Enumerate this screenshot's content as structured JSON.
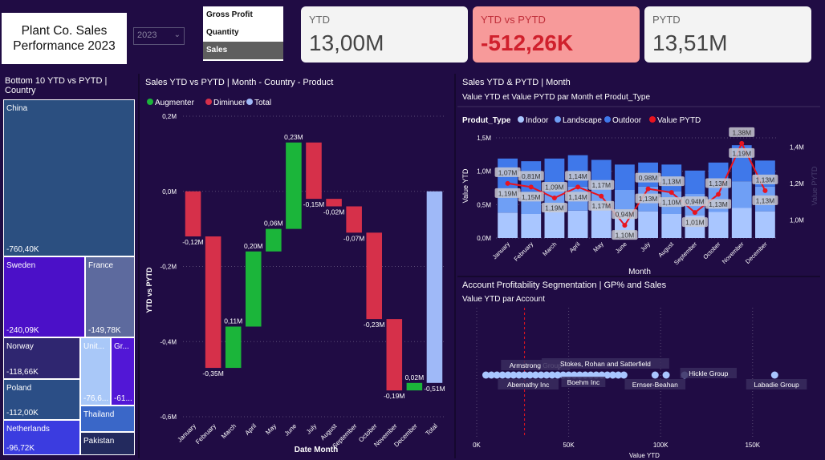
{
  "header": {
    "title_line1": "Plant Co. Sales",
    "title_line2": "Performance 2023",
    "year_value": "2023",
    "metric_options": [
      "Gross Profit",
      "Quantity",
      "Sales"
    ],
    "selected_metric": "Sales"
  },
  "kpis": [
    {
      "label": "YTD",
      "value": "13,00M"
    },
    {
      "label": "YTD vs PYTD",
      "value": "-512,26K"
    },
    {
      "label": "PYTD",
      "value": "13,51M"
    }
  ],
  "colors": {
    "increase": "#1bb53a",
    "decrease": "#d6304a",
    "total": "#9fb9f8",
    "indoor": "#a9c6ff",
    "landscape": "#6f9ff5",
    "outdoor": "#3f78ea",
    "pytd": "#e8141f",
    "treemap_blue": "#2b4f80",
    "treemap_purple": "#4b10c8"
  },
  "chart_data": [
    {
      "type": "treemap",
      "title": "Bottom 10 YTD vs PYTD | Country",
      "items": [
        {
          "name": "China",
          "label": "-760,40K"
        },
        {
          "name": "Sweden",
          "label": "-240,09K"
        },
        {
          "name": "France",
          "label": "-149,78K"
        },
        {
          "name": "Norway",
          "label": "-118,66K"
        },
        {
          "name": "Poland",
          "label": "-112,00K"
        },
        {
          "name": "Netherlands",
          "label": "-96,72K"
        },
        {
          "name": "Unit...",
          "label": "-76,6..."
        },
        {
          "name": "Gr...",
          "label": "-61..."
        },
        {
          "name": "Thailand",
          "label": ""
        },
        {
          "name": "Pakistan",
          "label": ""
        }
      ],
      "values": [
        -760.4,
        -240.09,
        -149.78,
        -118.66,
        -112.0,
        -96.72,
        -76.6,
        -61,
        -45,
        -42
      ]
    },
    {
      "type": "waterfall",
      "title": "Sales YTD vs PYTD | Month - Country - Product",
      "legend": [
        "Augmenter",
        "Diminuer",
        "Total"
      ],
      "xlabel": "Date Month",
      "ylabel": "YTD vs PYTD",
      "yticks": [
        "0,2M",
        "0,0M",
        "-0,2M",
        "-0,4M",
        "-0,6M"
      ],
      "ylim": [
        -0.6,
        0.2
      ],
      "categories": [
        "January",
        "February",
        "March",
        "April",
        "May",
        "June",
        "July",
        "August",
        "September",
        "October",
        "November",
        "December",
        "Total"
      ],
      "values": [
        -0.12,
        -0.35,
        0.11,
        0.2,
        0.06,
        0.23,
        -0.15,
        -0.02,
        -0.07,
        -0.23,
        -0.19,
        0.02,
        -0.51
      ],
      "labels": [
        "-0,12M",
        "-0,35M",
        "0,11M",
        "0,20M",
        "0,06M",
        "0,23M",
        "-0,15M",
        "-0,02M",
        "-0,07M",
        "-0,23M",
        "-0,19M",
        "0,02M",
        "-0,51M"
      ]
    },
    {
      "type": "bar",
      "title": "Sales YTD & PYTD | Month",
      "subtitle": "Value YTD et Value PYTD par Month et Produt_Type",
      "legend_title": "Produt_Type",
      "legend": [
        "Indoor",
        "Landscape",
        "Outdoor",
        "Value PYTD"
      ],
      "xlabel": "Month",
      "ylabel": "Value YTD",
      "y2label": "Value PYTD",
      "yticks": [
        "1,5M",
        "1,0M",
        "0,5M",
        "0,0M"
      ],
      "y2ticks": [
        "1,4M",
        "1,2M",
        "1,0M"
      ],
      "ylim": [
        0,
        1.5
      ],
      "y2lim": [
        0.9,
        1.45
      ],
      "categories": [
        "January",
        "February",
        "March",
        "April",
        "May",
        "June",
        "July",
        "August",
        "September",
        "October",
        "November",
        "December"
      ],
      "series": [
        {
          "name": "Indoor",
          "values": [
            0.38,
            0.36,
            0.42,
            0.41,
            0.45,
            0.38,
            0.4,
            0.36,
            0.34,
            0.39,
            0.45,
            0.4
          ]
        },
        {
          "name": "Landscape",
          "values": [
            0.35,
            0.33,
            0.38,
            0.36,
            0.39,
            0.34,
            0.37,
            0.34,
            0.32,
            0.36,
            0.4,
            0.37
          ]
        },
        {
          "name": "Outdoor",
          "values": [
            0.46,
            0.46,
            0.39,
            0.47,
            0.33,
            0.38,
            0.36,
            0.4,
            0.35,
            0.38,
            0.54,
            0.39
          ]
        }
      ],
      "totals": [
        1.19,
        1.15,
        1.19,
        1.14,
        1.17,
        1.1,
        1.13,
        1.1,
        1.01,
        1.13,
        1.19,
        1.13
      ],
      "pytd": [
        1.07,
        0.81,
        1.09,
        1.14,
        1.17,
        0.94,
        0.98,
        1.13,
        0.94,
        1.13,
        1.38,
        1.13
      ],
      "pytd_pos": [
        1.2,
        1.18,
        1.12,
        1.18,
        1.13,
        0.97,
        1.17,
        1.15,
        1.04,
        1.14,
        1.42,
        1.16
      ],
      "ytd_labels": [
        "1,19M",
        "1,15M",
        "1,19M",
        "1,14M",
        "1,17M",
        "1,10M",
        "1,13M",
        "1,10M",
        "1,01M",
        "1,13M",
        "1,19M",
        "1,13M"
      ],
      "pytd_labels": [
        "1,07M",
        "0,81M",
        "1,09M",
        "1,14M",
        "1,17M",
        "0,94M",
        "0,98M",
        "1,13M",
        "0,94M",
        "1,13M",
        "1,38M",
        "1,13M"
      ]
    },
    {
      "type": "scatter",
      "title": "Account Profitability Segmentation | GP% and Sales",
      "subtitle": "Value YTD par Account",
      "xlabel": "Value YTD",
      "xticks": [
        "0K",
        "50K",
        "100K",
        "150K"
      ],
      "xlim": [
        0,
        185
      ],
      "reference_x": 26,
      "points": [
        5,
        8,
        11,
        14,
        17,
        20,
        23,
        26,
        29,
        32,
        35,
        38,
        41,
        44,
        47,
        50,
        53,
        56,
        59,
        62,
        65,
        68,
        71,
        74,
        77,
        80,
        97,
        103,
        113,
        162
      ],
      "labels": [
        {
          "text": "Armstrong Group",
          "x": 32
        },
        {
          "text": "Abernathy Inc",
          "x": 28
        },
        {
          "text": "Stokes, Rohan and Satterfield",
          "x": 70
        },
        {
          "text": "Boehm Inc",
          "x": 58
        },
        {
          "text": "Ernser-Beahan",
          "x": 97
        },
        {
          "text": "Hickle Group",
          "x": 126
        },
        {
          "text": "Labadie Group",
          "x": 163
        }
      ]
    }
  ]
}
